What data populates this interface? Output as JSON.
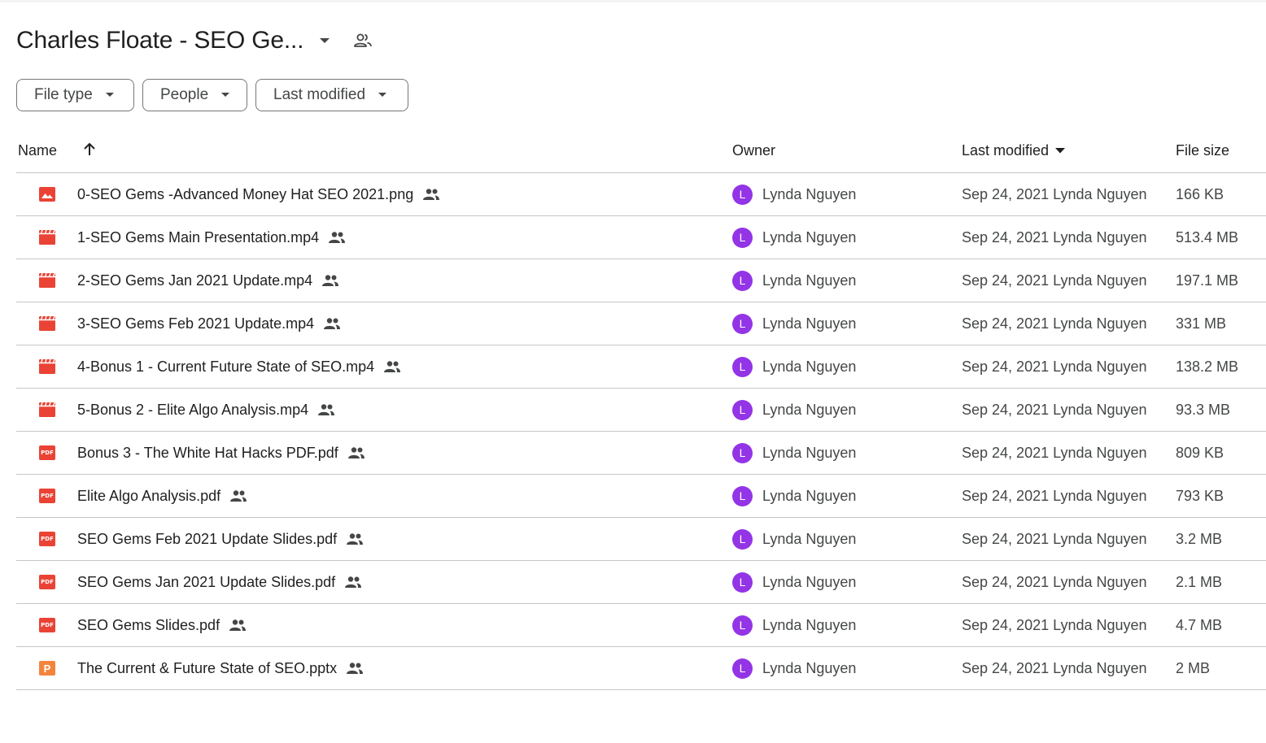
{
  "header": {
    "title": "Charles Floate - SEO Ge...",
    "accent": "#9334e6"
  },
  "filters": [
    {
      "label": "File type"
    },
    {
      "label": "People"
    },
    {
      "label": "Last modified"
    }
  ],
  "columns": {
    "name": "Name",
    "owner": "Owner",
    "last_modified": "Last modified",
    "file_size": "File size"
  },
  "files": [
    {
      "name": "0-SEO Gems -Advanced Money Hat SEO 2021.png",
      "type": "image-icon",
      "owner": "Lynda Nguyen",
      "owner_initial": "L",
      "modified": "Sep 24, 2021 Lynda Nguyen",
      "size": "166 KB"
    },
    {
      "name": "1-SEO Gems Main Presentation.mp4",
      "type": "video-icon",
      "owner": "Lynda Nguyen",
      "owner_initial": "L",
      "modified": "Sep 24, 2021 Lynda Nguyen",
      "size": "513.4 MB"
    },
    {
      "name": "2-SEO Gems Jan 2021 Update.mp4",
      "type": "video-icon",
      "owner": "Lynda Nguyen",
      "owner_initial": "L",
      "modified": "Sep 24, 2021 Lynda Nguyen",
      "size": "197.1 MB"
    },
    {
      "name": "3-SEO Gems Feb 2021 Update.mp4",
      "type": "video-icon",
      "owner": "Lynda Nguyen",
      "owner_initial": "L",
      "modified": "Sep 24, 2021 Lynda Nguyen",
      "size": "331 MB"
    },
    {
      "name": "4-Bonus 1 - Current Future State of SEO.mp4",
      "type": "video-icon",
      "owner": "Lynda Nguyen",
      "owner_initial": "L",
      "modified": "Sep 24, 2021 Lynda Nguyen",
      "size": "138.2 MB"
    },
    {
      "name": "5-Bonus 2 - Elite Algo Analysis.mp4",
      "type": "video-icon",
      "owner": "Lynda Nguyen",
      "owner_initial": "L",
      "modified": "Sep 24, 2021 Lynda Nguyen",
      "size": "93.3 MB"
    },
    {
      "name": "Bonus 3 - The White Hat Hacks PDF.pdf",
      "type": "pdf-icon",
      "owner": "Lynda Nguyen",
      "owner_initial": "L",
      "modified": "Sep 24, 2021 Lynda Nguyen",
      "size": "809 KB"
    },
    {
      "name": "Elite Algo Analysis.pdf",
      "type": "pdf-icon",
      "owner": "Lynda Nguyen",
      "owner_initial": "L",
      "modified": "Sep 24, 2021 Lynda Nguyen",
      "size": "793 KB"
    },
    {
      "name": "SEO Gems Feb 2021 Update Slides.pdf",
      "type": "pdf-icon",
      "owner": "Lynda Nguyen",
      "owner_initial": "L",
      "modified": "Sep 24, 2021 Lynda Nguyen",
      "size": "3.2 MB"
    },
    {
      "name": "SEO Gems Jan 2021 Update Slides.pdf",
      "type": "pdf-icon",
      "owner": "Lynda Nguyen",
      "owner_initial": "L",
      "modified": "Sep 24, 2021 Lynda Nguyen",
      "size": "2.1 MB"
    },
    {
      "name": "SEO Gems Slides.pdf",
      "type": "pdf-icon",
      "owner": "Lynda Nguyen",
      "owner_initial": "L",
      "modified": "Sep 24, 2021 Lynda Nguyen",
      "size": "4.7 MB"
    },
    {
      "name": "The Current & Future State of SEO.pptx",
      "type": "slides-icon",
      "owner": "Lynda Nguyen",
      "owner_initial": "L",
      "modified": "Sep 24, 2021 Lynda Nguyen",
      "size": "2 MB"
    }
  ],
  "icons": {
    "pdf_glyph": "PDF",
    "pptx_glyph": "P"
  }
}
